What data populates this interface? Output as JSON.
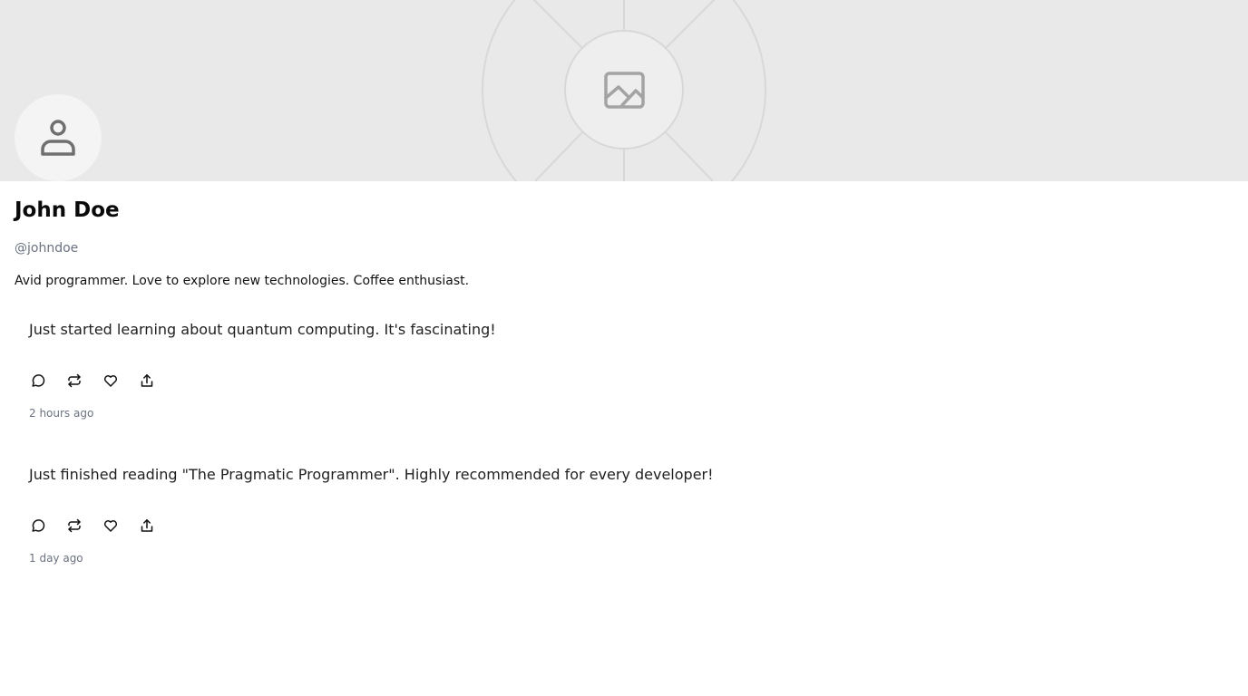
{
  "profile": {
    "name": "John Doe",
    "handle": "@johndoe",
    "bio": "Avid programmer. Love to explore new technologies. Coffee enthusiast."
  },
  "banner": {
    "icon": "image-placeholder-icon",
    "background": "#e9e9e9"
  },
  "avatar": {
    "icon": "person-icon"
  },
  "posts": [
    {
      "text": "Just started learning about quantum computing. It's fascinating!",
      "time": "2 hours ago",
      "actions": [
        "comment-icon",
        "repost-icon",
        "like-icon",
        "share-icon"
      ]
    },
    {
      "text": "Just finished reading \"The Pragmatic Programmer\". Highly recommended for every developer!",
      "time": "1 day ago",
      "actions": [
        "comment-icon",
        "repost-icon",
        "like-icon",
        "share-icon"
      ]
    }
  ],
  "colors": {
    "muted_text": "#6b7280",
    "icon_gray": "#6f6f6f"
  }
}
